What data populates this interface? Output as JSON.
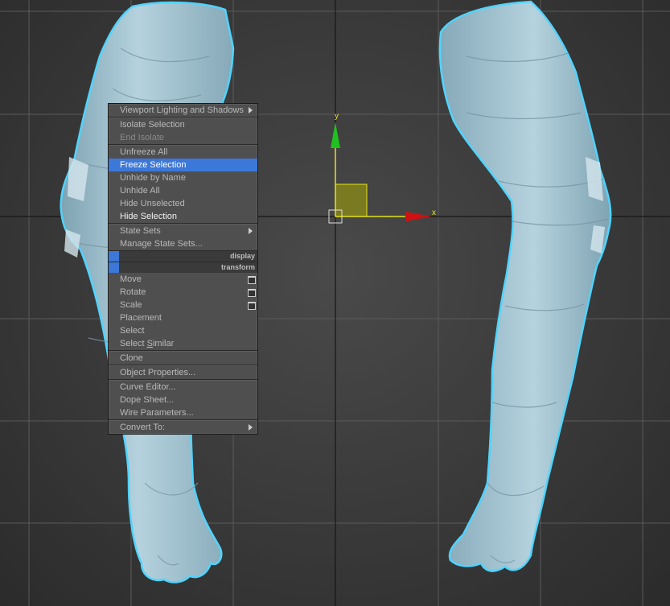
{
  "viewport": {
    "gizmo": {
      "y_label": "y",
      "x_label": "x",
      "y_color": "#20c020",
      "x_color": "#d01010",
      "plane_color": "#8c8c18"
    },
    "model_color": "#a9c8d4",
    "outline_color": "#4fd4ff"
  },
  "quad_menu": {
    "display_header": "display",
    "transform_header": "transform",
    "display_items": [
      {
        "label": "Viewport Lighting and Shadows",
        "state": "normal",
        "submenu": true
      },
      {
        "label": "Isolate Selection",
        "state": "normal"
      },
      {
        "label": "End Isolate",
        "state": "disabled"
      },
      {
        "label": "Unfreeze All",
        "state": "normal"
      },
      {
        "label": "Freeze Selection",
        "state": "selected"
      },
      {
        "label": "Unhide by Name",
        "state": "normal"
      },
      {
        "label": "Unhide All",
        "state": "normal"
      },
      {
        "label": "Hide Unselected",
        "state": "normal"
      },
      {
        "label": "Hide Selection",
        "state": "bright"
      },
      {
        "label": "State Sets",
        "state": "normal",
        "submenu": true
      },
      {
        "label": "Manage State Sets...",
        "state": "normal"
      }
    ],
    "transform_items": [
      {
        "label": "Move",
        "state": "normal",
        "settings": true
      },
      {
        "label": "Rotate",
        "state": "normal",
        "settings": true
      },
      {
        "label": "Scale",
        "state": "normal",
        "settings": true
      },
      {
        "label": "Placement",
        "state": "normal"
      },
      {
        "label": "Select",
        "state": "normal"
      },
      {
        "label_pre": "Select ",
        "label_ul": "S",
        "label_post": "imilar",
        "state": "normal"
      },
      {
        "label": "Clone",
        "state": "normal"
      },
      {
        "label": "Object Properties...",
        "state": "normal"
      },
      {
        "label": "Curve Editor...",
        "state": "normal"
      },
      {
        "label": "Dope Sheet...",
        "state": "normal"
      },
      {
        "label": "Wire Parameters...",
        "state": "normal"
      },
      {
        "label": "Convert To:",
        "state": "normal",
        "submenu": true
      }
    ]
  }
}
